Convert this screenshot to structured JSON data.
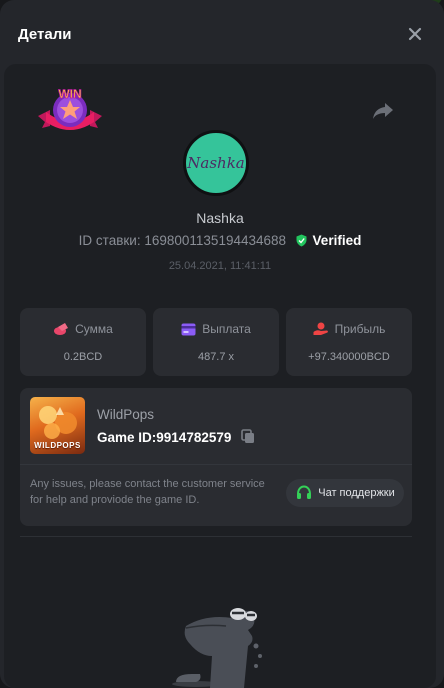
{
  "header": {
    "title": "Детали"
  },
  "player": {
    "avatar_text": "Nashka",
    "name": "Nashka",
    "bet_id_label": "ID ставки:",
    "bet_id": "1698001135194434688",
    "verified_label": "Verified",
    "datetime": "25.04.2021, 11:41:11"
  },
  "badge": {
    "text": "WIN"
  },
  "stats": [
    {
      "label": "Сумма",
      "value": "0.2BCD",
      "icon": "coins-icon",
      "color": "#e8466a"
    },
    {
      "label": "Выплата",
      "value": "487.7 x",
      "icon": "card-icon",
      "color": "#8b5cf6"
    },
    {
      "label": "Прибыль",
      "value": "+97.340000BCD",
      "icon": "hand-coin-icon",
      "color": "#ef4444"
    }
  ],
  "game": {
    "thumb_label": "WILDPOPS",
    "name": "WildPops",
    "id_label": "Game ID:",
    "id": "9914782579",
    "issue_text": "Any issues, please contact the customer service for help and proviode the game ID.",
    "support_label": "Чат поддержки"
  },
  "colors": {
    "accent_green": "#34d158",
    "verified": "#22c55e"
  }
}
